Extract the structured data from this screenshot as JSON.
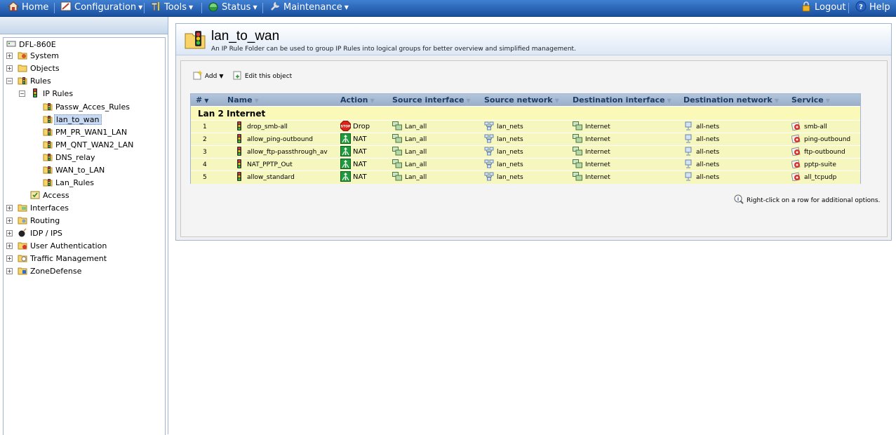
{
  "menu": {
    "home": "Home",
    "configuration": "Configuration",
    "tools": "Tools",
    "status": "Status",
    "maintenance": "Maintenance",
    "logout": "Logout",
    "help": "Help"
  },
  "tree": {
    "root": "DFL-860E",
    "system": "System",
    "objects": "Objects",
    "rules": "Rules",
    "ip_rules": "IP Rules",
    "folders": [
      "Passw_Acces_Rules",
      "lan_to_wan",
      "PM_PR_WAN1_LAN",
      "PM_QNT_WAN2_LAN",
      "DNS_relay",
      "WAN_to_LAN",
      "Lan_Rules"
    ],
    "access": "Access",
    "interfaces": "Interfaces",
    "routing": "Routing",
    "idp": "IDP / IPS",
    "user_auth": "User Authentication",
    "traffic": "Traffic Management",
    "zonedefense": "ZoneDefense"
  },
  "page": {
    "title": "lan_to_wan",
    "description": "An IP Rule Folder can be used to group IP Rules into logical groups for better overview and simplified management."
  },
  "toolbar": {
    "add": "Add",
    "edit": "Edit this object"
  },
  "table": {
    "headers": [
      "#",
      "Name",
      "Action",
      "Source interface",
      "Source network",
      "Destination interface",
      "Destination network",
      "Service"
    ],
    "group": "Lan 2 Internet",
    "rows": [
      {
        "num": "1",
        "name": "drop_smb-all",
        "action": "Drop",
        "src_if": "Lan_all",
        "src_net": "lan_nets",
        "dst_if": "Internet",
        "dst_net": "all-nets",
        "service": "smb-all"
      },
      {
        "num": "2",
        "name": "allow_ping-outbound",
        "action": "NAT",
        "src_if": "Lan_all",
        "src_net": "lan_nets",
        "dst_if": "Internet",
        "dst_net": "all-nets",
        "service": "ping-outbound"
      },
      {
        "num": "3",
        "name": "allow_ftp-passthrough_av",
        "action": "NAT",
        "src_if": "Lan_all",
        "src_net": "lan_nets",
        "dst_if": "Internet",
        "dst_net": "all-nets",
        "service": "ftp-outbound"
      },
      {
        "num": "4",
        "name": "NAT_PPTP_Out",
        "action": "NAT",
        "src_if": "Lan_all",
        "src_net": "lan_nets",
        "dst_if": "Internet",
        "dst_net": "all-nets",
        "service": "pptp-suite"
      },
      {
        "num": "5",
        "name": "allow_standard",
        "action": "NAT",
        "src_if": "Lan_all",
        "src_net": "lan_nets",
        "dst_if": "Internet",
        "dst_net": "all-nets",
        "service": "all_tcpudp"
      }
    ]
  },
  "hint": "Right-click on a row for additional options."
}
